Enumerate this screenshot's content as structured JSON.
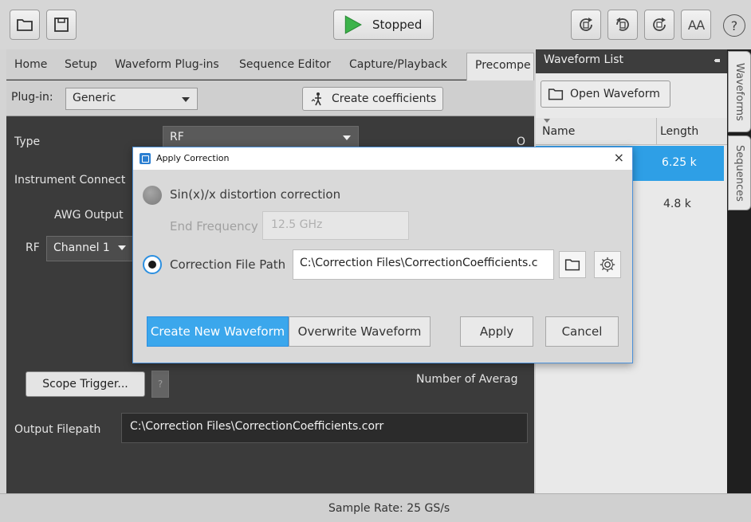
{
  "toolbar": {
    "run_label": "Stopped",
    "aa_label": "AA",
    "help_label": "?"
  },
  "tabs": [
    "Home",
    "Setup",
    "Waveform Plug-ins",
    "Sequence Editor",
    "Capture/Playback",
    "Precompe"
  ],
  "plugin": {
    "label": "Plug-in:",
    "value": "Generic",
    "create_label": "Create coefficients"
  },
  "panel": {
    "type_label": "Type",
    "type_value": "RF",
    "right_cut": "O",
    "instrument_label": "Instrument Connect",
    "awg_label": "AWG Output",
    "rf_label": "RF",
    "channel_value": "Channel 1",
    "scope_trigger": "Scope Trigger...",
    "help_small": "?",
    "averages_label": "Number of Averag",
    "output_label": "Output Filepath",
    "output_value": "C:\\Correction Files\\CorrectionCoefficients.corr"
  },
  "waveform_list": {
    "title": "Waveform List",
    "open_label": "Open Waveform",
    "col_name": "Name",
    "col_length": "Length",
    "rows": [
      {
        "name": "",
        "length": "6.25 k",
        "selected": true
      },
      {
        "name": "",
        "length": "4.8 k",
        "selected": false
      }
    ]
  },
  "side_tabs": [
    "Waveforms",
    "Sequences"
  ],
  "status": {
    "sample_rate": "Sample Rate: 25 GS/s"
  },
  "dialog": {
    "title": "Apply Correction",
    "close": "×",
    "sinx_label": "Sin(x)/x distortion correction",
    "endfreq_label": "End Frequency",
    "endfreq_value": "12.5 GHz",
    "corr_label": "Correction File Path",
    "corr_value": "C:\\Correction Files\\CorrectionCoefficients.c",
    "create_new": "Create New Waveform",
    "overwrite": "Overwrite Waveform",
    "apply": "Apply",
    "cancel": "Cancel"
  },
  "colors": {
    "accent": "#2e9fe6",
    "run_green": "#3cb34a",
    "dark_panel": "#3b3b3b"
  }
}
